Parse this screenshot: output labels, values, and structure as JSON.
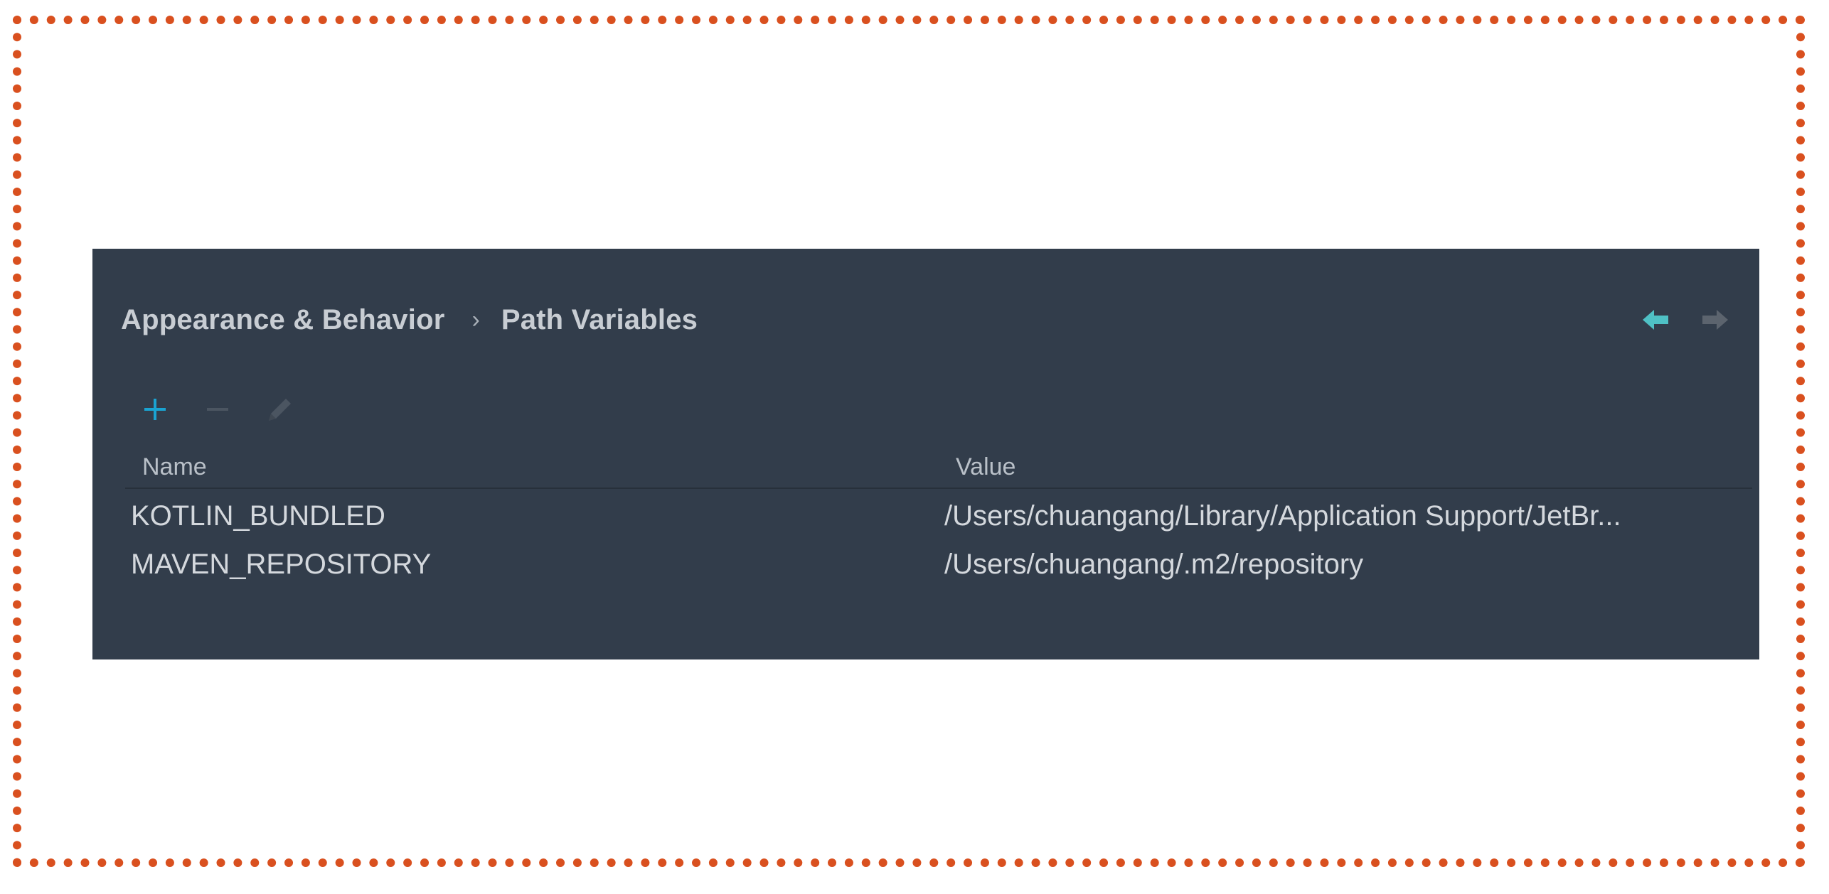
{
  "breadcrumb": {
    "parent": "Appearance & Behavior",
    "separator": "›",
    "current": "Path Variables"
  },
  "navigation": {
    "back_icon": "arrow-left-icon",
    "forward_icon": "arrow-right-icon",
    "back_color": "#4fc1c5",
    "forward_color": "#5c646e"
  },
  "toolbar": {
    "add_icon": "plus-icon",
    "remove_icon": "minus-icon",
    "edit_icon": "pencil-icon",
    "add_color": "#1aa3d1"
  },
  "table": {
    "columns": [
      "Name",
      "Value"
    ],
    "rows": [
      {
        "name": "KOTLIN_BUNDLED",
        "value": "/Users/chuangang/Library/Application Support/JetBr..."
      },
      {
        "name": "MAVEN_REPOSITORY",
        "value": "/Users/chuangang/.m2/repository"
      }
    ]
  },
  "colors": {
    "panel_bg": "#323d4b",
    "frame_border": "#d9501f"
  }
}
